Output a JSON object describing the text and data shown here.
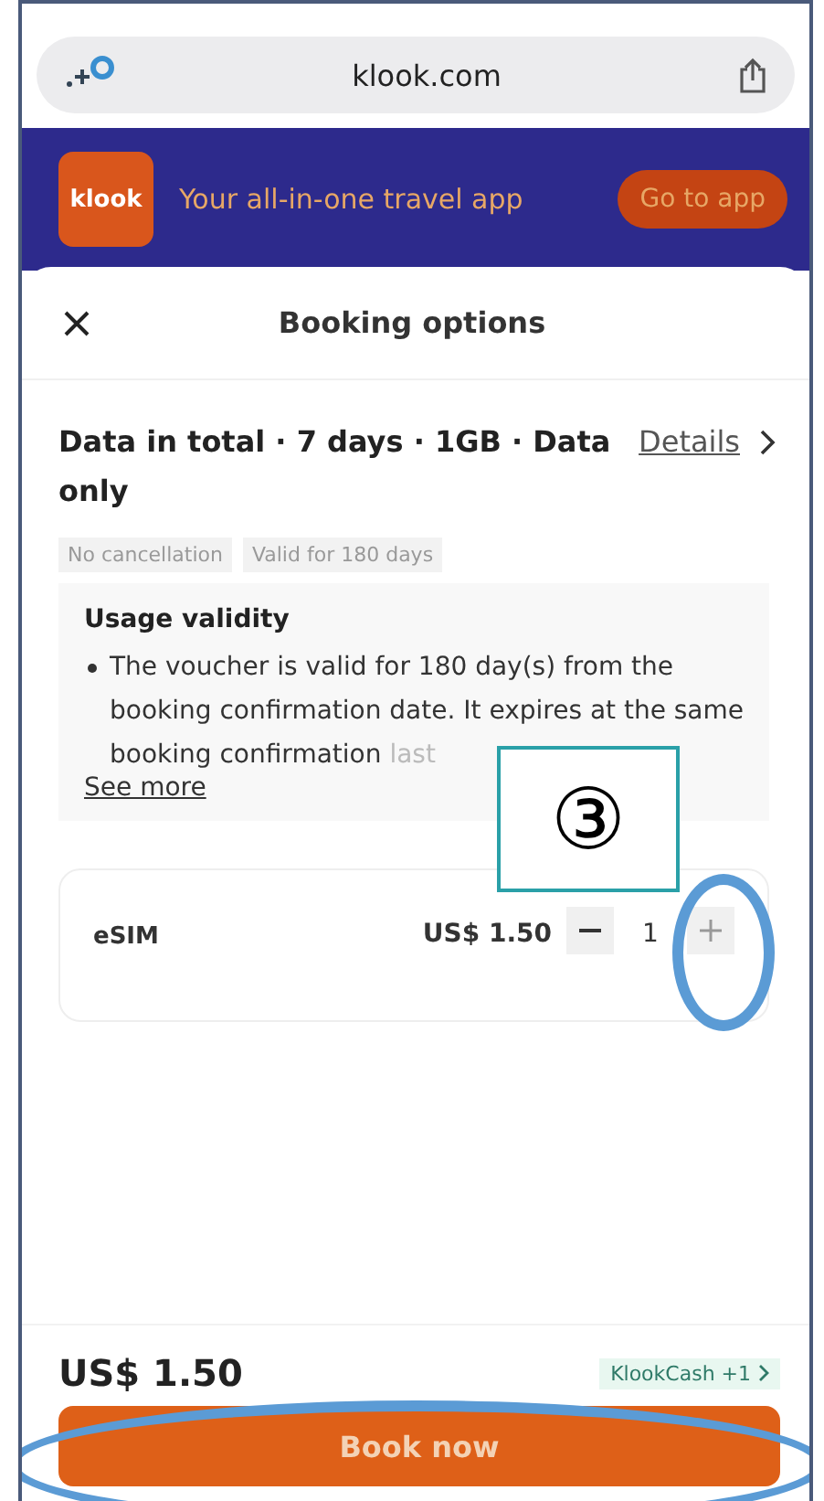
{
  "browser": {
    "url": "klook.com"
  },
  "banner": {
    "logo": "klook",
    "text": "Your all-in-one travel app",
    "button": "Go to app"
  },
  "sheet": {
    "title": "Booking options"
  },
  "package": {
    "name": "Data in total · 7 days · 1GB · Data only",
    "details": "Details",
    "tags": [
      "No cancellation",
      "Valid for 180 days"
    ],
    "usage": {
      "heading": "Usage validity",
      "text": "The voucher is valid for 180 day(s) from the booking confirmation date. It expires at the same booking confirmation",
      "tail": "last",
      "see_more": "See more"
    }
  },
  "items": [
    {
      "name": "eSIM",
      "price": "US$ 1.50",
      "quantity": "1"
    }
  ],
  "footer": {
    "total": "US$ 1.50",
    "reward": "KlookCash +1",
    "button": "Book now"
  },
  "annotation": {
    "step": "③"
  }
}
